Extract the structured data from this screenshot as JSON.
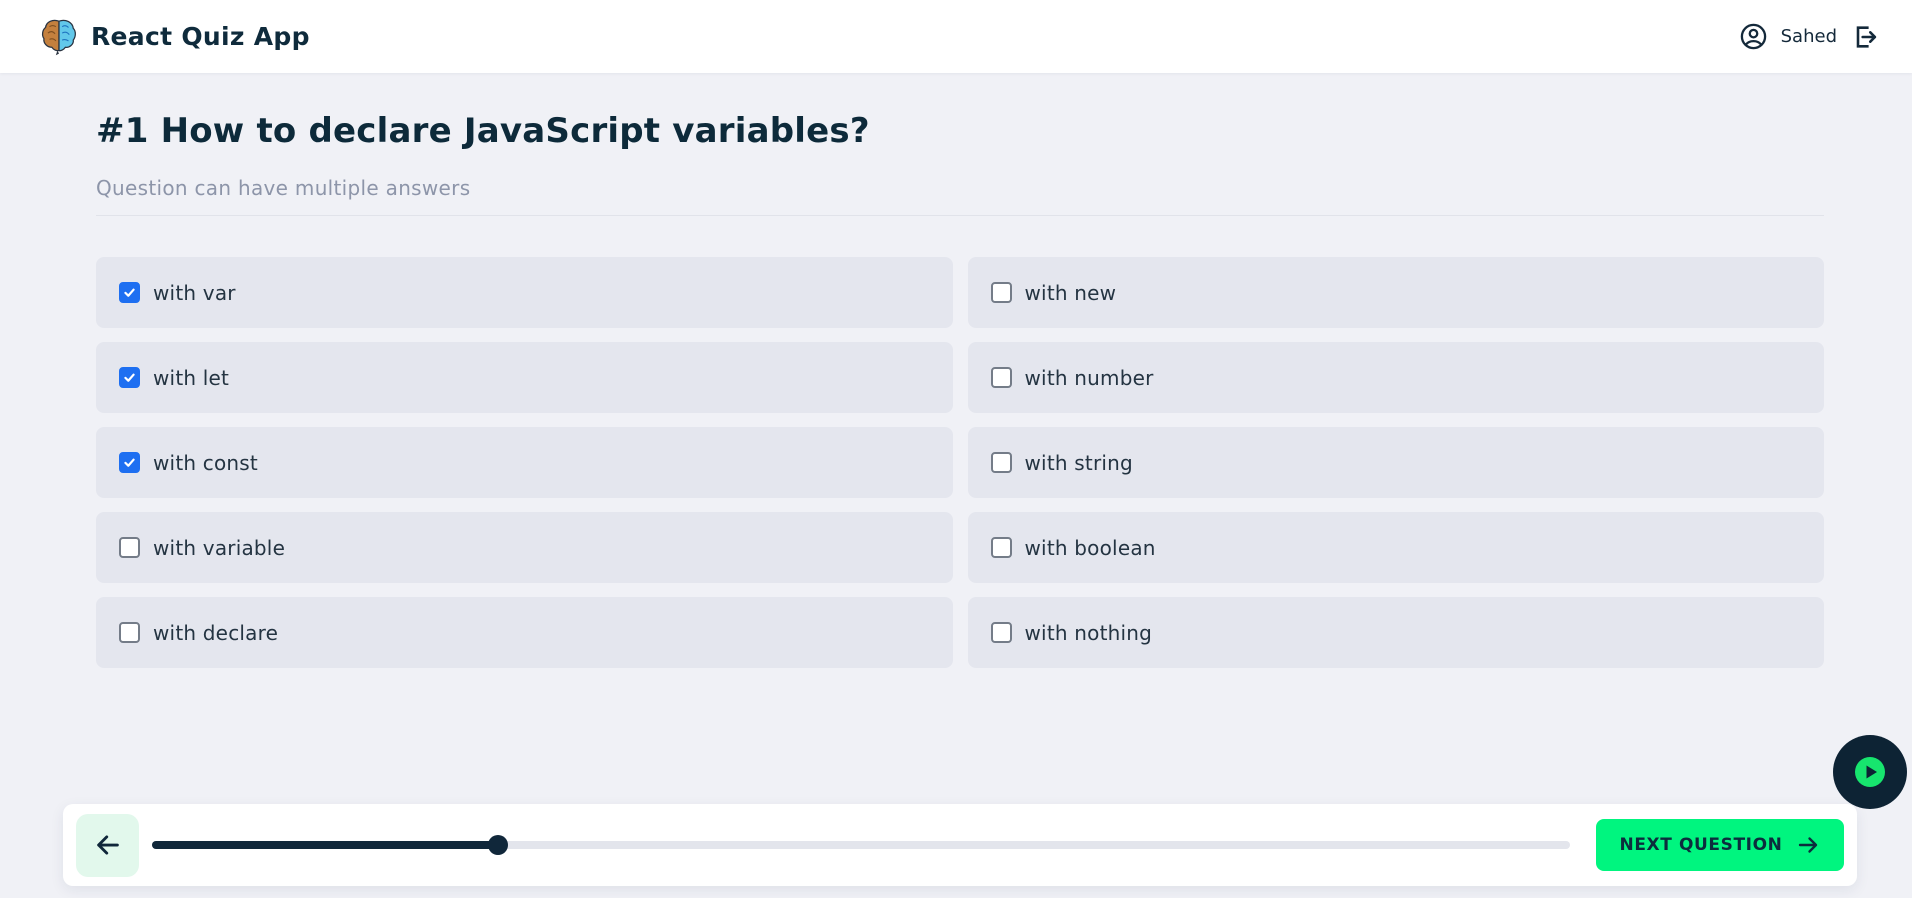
{
  "header": {
    "app_title": "React Quiz App",
    "username": "Sahed"
  },
  "question": {
    "title": "#1 How to declare JavaScript variables?",
    "subtitle": "Question can have multiple answers"
  },
  "options": [
    {
      "label": "with var",
      "checked": true
    },
    {
      "label": "with new",
      "checked": false
    },
    {
      "label": "with let",
      "checked": true
    },
    {
      "label": "with number",
      "checked": false
    },
    {
      "label": "with const",
      "checked": true
    },
    {
      "label": "with string",
      "checked": false
    },
    {
      "label": "with variable",
      "checked": false
    },
    {
      "label": "with boolean",
      "checked": false
    },
    {
      "label": "with declare",
      "checked": false
    },
    {
      "label": "with nothing",
      "checked": false
    }
  ],
  "footer": {
    "next_label": "NEXT QUESTION",
    "slider": {
      "percent": 24.4
    }
  },
  "colors": {
    "accent_green": "#00f57f",
    "dark_navy": "#0e2433",
    "checkbox_blue": "#1e6ff1",
    "page_bg": "#f0f1f6",
    "card_bg": "#e4e6ee",
    "back_button_bg": "#e2f8ec",
    "subtitle_gray": "#8d95a9"
  }
}
